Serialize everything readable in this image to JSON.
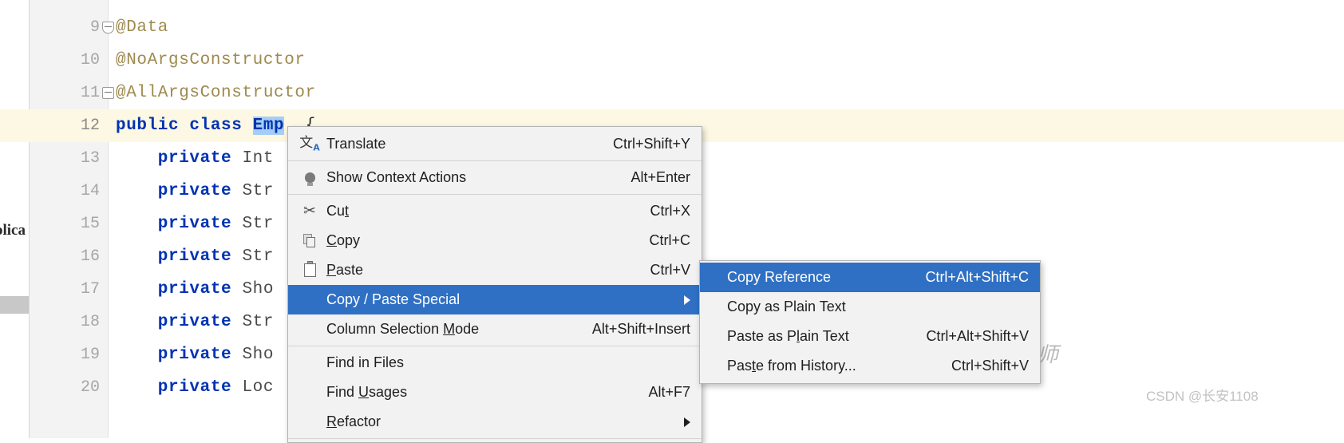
{
  "editor": {
    "left_clip_text": "olica",
    "lines": [
      {
        "number": "9",
        "current": false,
        "fold": "start",
        "segments": [
          {
            "text": "@Data",
            "kind": "anno"
          }
        ]
      },
      {
        "number": "10",
        "current": false,
        "fold": "none",
        "segments": [
          {
            "text": "@NoArgsConstructor",
            "kind": "anno"
          }
        ]
      },
      {
        "number": "11",
        "current": false,
        "fold": "end",
        "segments": [
          {
            "text": "@AllArgsConstructor",
            "kind": "anno"
          }
        ]
      },
      {
        "number": "12",
        "current": true,
        "fold": "none",
        "segments": [
          {
            "text": "public class ",
            "kind": "kw"
          },
          {
            "text": "Emp",
            "kind": "sel"
          },
          {
            "text": "  {",
            "kind": "plain"
          }
        ]
      },
      {
        "number": "13",
        "current": false,
        "fold": "none",
        "segments": [
          {
            "text": "    private ",
            "kind": "kw"
          },
          {
            "text": "Int",
            "kind": "type"
          }
        ]
      },
      {
        "number": "14",
        "current": false,
        "fold": "none",
        "segments": [
          {
            "text": "    private ",
            "kind": "kw"
          },
          {
            "text": "Str",
            "kind": "type"
          }
        ]
      },
      {
        "number": "15",
        "current": false,
        "fold": "none",
        "segments": [
          {
            "text": "    private ",
            "kind": "kw"
          },
          {
            "text": "Str",
            "kind": "type"
          }
        ]
      },
      {
        "number": "16",
        "current": false,
        "fold": "none",
        "segments": [
          {
            "text": "    private ",
            "kind": "kw"
          },
          {
            "text": "Str",
            "kind": "type"
          }
        ]
      },
      {
        "number": "17",
        "current": false,
        "fold": "none",
        "segments": [
          {
            "text": "    private ",
            "kind": "kw"
          },
          {
            "text": "Sho",
            "kind": "type"
          }
        ]
      },
      {
        "number": "18",
        "current": false,
        "fold": "none",
        "segments": [
          {
            "text": "    private ",
            "kind": "kw"
          },
          {
            "text": "Str",
            "kind": "type"
          }
        ]
      },
      {
        "number": "19",
        "current": false,
        "fold": "none",
        "segments": [
          {
            "text": "    private ",
            "kind": "kw"
          },
          {
            "text": "Sho",
            "kind": "type"
          }
        ]
      },
      {
        "number": "20",
        "current": false,
        "fold": "none",
        "segments": [
          {
            "text": "    private ",
            "kind": "kw"
          },
          {
            "text": "Loc",
            "kind": "type"
          }
        ]
      }
    ]
  },
  "context_menu": {
    "items": [
      {
        "id": "translate",
        "label": "Translate",
        "mnemonic": "",
        "shortcut": "Ctrl+Shift+Y",
        "icon": "translate-icon",
        "selected": false,
        "submenu": false,
        "separator_after": true
      },
      {
        "id": "show-context-actions",
        "label": "Show Context Actions",
        "mnemonic": "",
        "shortcut": "Alt+Enter",
        "icon": "lightbulb-icon",
        "selected": false,
        "submenu": false,
        "separator_after": true
      },
      {
        "id": "cut",
        "label": "Cut",
        "mnemonic": "t",
        "shortcut": "Ctrl+X",
        "icon": "scissors-icon",
        "selected": false,
        "submenu": false,
        "separator_after": false
      },
      {
        "id": "copy",
        "label": "Copy",
        "mnemonic": "C",
        "shortcut": "Ctrl+C",
        "icon": "copy-icon",
        "selected": false,
        "submenu": false,
        "separator_after": false
      },
      {
        "id": "paste",
        "label": "Paste",
        "mnemonic": "P",
        "shortcut": "Ctrl+V",
        "icon": "paste-icon",
        "selected": false,
        "submenu": false,
        "separator_after": false
      },
      {
        "id": "copy-paste-special",
        "label": "Copy / Paste Special",
        "mnemonic": "",
        "shortcut": "",
        "icon": "",
        "selected": true,
        "submenu": true,
        "separator_after": false
      },
      {
        "id": "column-selection-mode",
        "label": "Column Selection Mode",
        "mnemonic": "M",
        "shortcut": "Alt+Shift+Insert",
        "icon": "",
        "selected": false,
        "submenu": false,
        "separator_after": true
      },
      {
        "id": "find-in-files",
        "label": "Find in Files",
        "mnemonic": "",
        "shortcut": "",
        "icon": "",
        "selected": false,
        "submenu": false,
        "separator_after": false
      },
      {
        "id": "find-usages",
        "label": "Find Usages",
        "mnemonic": "U",
        "shortcut": "Alt+F7",
        "icon": "",
        "selected": false,
        "submenu": false,
        "separator_after": false
      },
      {
        "id": "refactor",
        "label": "Refactor",
        "mnemonic": "R",
        "shortcut": "",
        "icon": "",
        "selected": false,
        "submenu": true,
        "separator_after": true
      }
    ]
  },
  "sub_menu": {
    "items": [
      {
        "id": "copy-reference",
        "label": "Copy Reference",
        "mnemonic": "",
        "shortcut": "Ctrl+Alt+Shift+C",
        "selected": true
      },
      {
        "id": "copy-as-plain-text",
        "label": "Copy as Plain Text",
        "mnemonic": "",
        "shortcut": "",
        "selected": false
      },
      {
        "id": "paste-as-plain-text",
        "label": "Paste as Plain Text",
        "mnemonic": "l",
        "shortcut": "Ctrl+Alt+Shift+V",
        "selected": false
      },
      {
        "id": "paste-from-history",
        "label": "Paste from History...",
        "mnemonic": "t",
        "shortcut": "Ctrl+Shift+V",
        "selected": false
      }
    ]
  },
  "watermarks": {
    "chinese": "师",
    "csdn": "CSDN @长安1108"
  },
  "colors": {
    "selection_blue": "#2f70c4",
    "menu_bg": "#f2f2f2",
    "current_line": "#fdf8e3",
    "text_selection": "#a6cdf5",
    "keyword": "#0033b3",
    "annotation": "#9e8a4e"
  }
}
